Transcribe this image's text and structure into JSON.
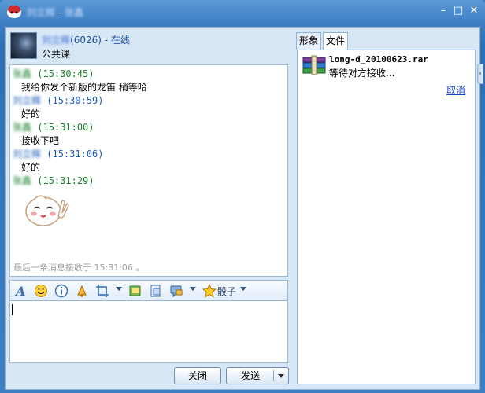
{
  "window": {
    "title_name": "刘立辉",
    "title_sep": " - ",
    "title_peer": "张鑫",
    "min": "–",
    "max": "□",
    "close": "✕"
  },
  "contact": {
    "name": "刘立辉",
    "id": "(6026)",
    "status": " - 在线",
    "signature": "公共课"
  },
  "chat": {
    "messages": [
      {
        "sender": "张鑫",
        "time": "(15:30:45)",
        "text": "我给你发个新版的龙笛 稍等哈",
        "me": false
      },
      {
        "sender": "刘立辉",
        "time": "(15:30:59)",
        "text": "好的",
        "me": true
      },
      {
        "sender": "张鑫",
        "time": "(15:31:00)",
        "text": "接收下吧",
        "me": false
      },
      {
        "sender": "刘立辉",
        "time": "(15:31:06)",
        "text": "好的",
        "me": true
      },
      {
        "sender": "张鑫",
        "time": "(15:31:29)",
        "text": "",
        "me": false
      }
    ],
    "last_received": "最后一条消息接收于 15:31:06 。"
  },
  "toolbar": {
    "dice_label": "骰子"
  },
  "buttons": {
    "close": "关闭",
    "send": "发送"
  },
  "right_panel": {
    "tab_avatar": "形象",
    "tab_file": "文件",
    "file_name": "long-d_20100623.rar",
    "file_status": "等待对方接收...",
    "cancel": "取消"
  },
  "colors": {
    "title_bar": "#3d7ec4",
    "peer_name": "#1b7f2e",
    "my_name": "#1c5fb8",
    "link": "#1846c8"
  }
}
